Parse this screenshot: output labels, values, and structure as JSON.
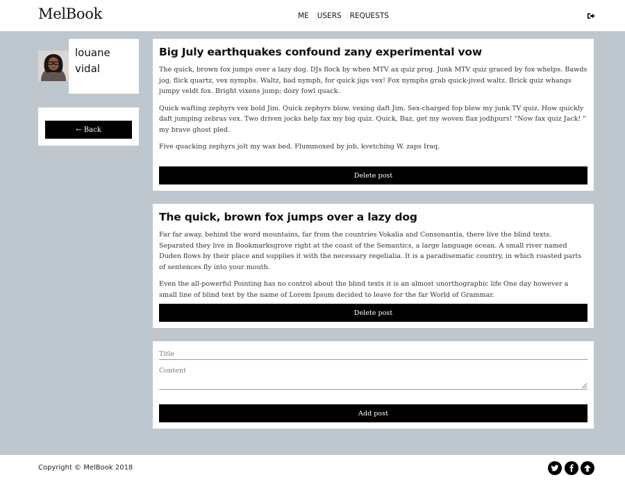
{
  "header": {
    "logo": "MelBook",
    "nav": [
      "ME",
      "USERS",
      "REQUESTS"
    ],
    "logout_icon": "logout-icon"
  },
  "profile": {
    "first_name": "louane",
    "last_name": "vidal",
    "back_label": "← Back"
  },
  "posts": [
    {
      "title": "Big July earthquakes confound zany experimental vow",
      "paragraphs": [
        "The quick, brown fox jumps over a lazy dog. DJs flock by when MTV ax quiz prog. Junk MTV quiz graced by fox whelps. Bawds jog, flick quartz, vex nymphs. Waltz, bad nymph, for quick jigs vex! Fox nymphs grab quick-jived waltz. Brick quiz whangs jumpy veldt fox. Bright vixens jump; dozy fowl quack.",
        "Quick wafting zephyrs vex bold Jim. Quick zephyrs blow, vexing daft Jim. Sex-charged fop blew my junk TV quiz. How quickly daft jumping zebras vex. Two driven jocks help fax my big quiz. Quick, Baz, get my woven flax jodhpurs! \"Now fax quiz Jack! \" my brave ghost pled.",
        "Five quacking zephyrs jolt my wax bed. Flummoxed by job, kvetching W. zaps Iraq."
      ],
      "delete_label": "Delete post"
    },
    {
      "title": "The quick, brown fox jumps over a lazy dog",
      "paragraphs": [
        "Far far away, behind the word mountains, far from the countries Vokalia and Consonantia, there live the blind texts. Separated they live in Bookmarksgrove right at the coast of the Semantics, a large language ocean. A small river named Duden flows by their place and supplies it with the necessary regelialia. It is a paradisematic country, in which roasted parts of sentences fly into your mouth.",
        "Even the all-powerful Pointing has no control about the blind texts it is an almost unorthographic life One day however a small line of blind text by the name of Lorem Ipsum decided to leave for the far World of Grammar."
      ],
      "delete_label": "Delete post"
    }
  ],
  "form": {
    "title_placeholder": "Title",
    "content_placeholder": "Content",
    "add_label": "Add post"
  },
  "footer": {
    "copyright": "Copyright © MelBook 2018",
    "social": [
      "twitter-icon",
      "facebook-icon",
      "arrow-up-icon"
    ]
  },
  "colors": {
    "page_bg": "#bec7cd",
    "card_bg": "#ffffff",
    "button_bg": "#000000",
    "button_text": "#ffffff"
  }
}
